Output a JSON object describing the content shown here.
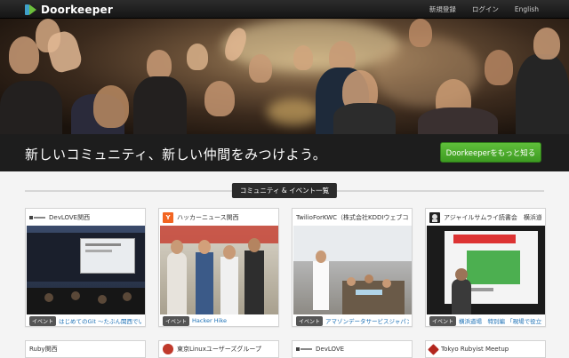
{
  "brand": {
    "name": "Doorkeeper"
  },
  "nav": {
    "signup": "新規登録",
    "login": "ログイン",
    "language": "English"
  },
  "hero": {
    "tagline": "新しいコミュニティ、新しい仲間をみつけよう。",
    "cta": "Doorkeeperをもっと知る"
  },
  "section": {
    "title": "コミュニティ & イベント一覧"
  },
  "badge_label": "イベント",
  "cards": [
    {
      "title": "DevLOVE関西",
      "icon": "devlove-logo-icon",
      "icon_text": "",
      "event": "はじめてのGit ～たぶん関西でい"
    },
    {
      "title": "ハッカーニュース関西",
      "icon": "y-logo-icon",
      "icon_text": "Y",
      "event": "Hacker Hike"
    },
    {
      "title": "TwilioForKWC（株式会社KDDIウェブコミュ",
      "icon": "",
      "icon_text": "",
      "event": "アマゾンデータサービスジャパン"
    },
    {
      "title": "アジャイルサムライ読書会　横浜道場",
      "icon": "agile-samurai-icon",
      "icon_text": "",
      "event": "横浜道場　特別編 「現場で役立つ"
    }
  ],
  "cards_row2": [
    {
      "title": "Ruby関西",
      "icon": ""
    },
    {
      "title": "東京Linuxユーザーズグループ",
      "icon": "tlug-logo-icon"
    },
    {
      "title": "DevLOVE",
      "icon": "devlove-logo-icon"
    },
    {
      "title": "Tokyo Rubyist Meetup",
      "icon": "ruby-logo-icon"
    }
  ],
  "colors": {
    "accent_green": "#4aa82b",
    "link_blue": "#1a6fb5",
    "navbar": "#1d1d1d"
  }
}
